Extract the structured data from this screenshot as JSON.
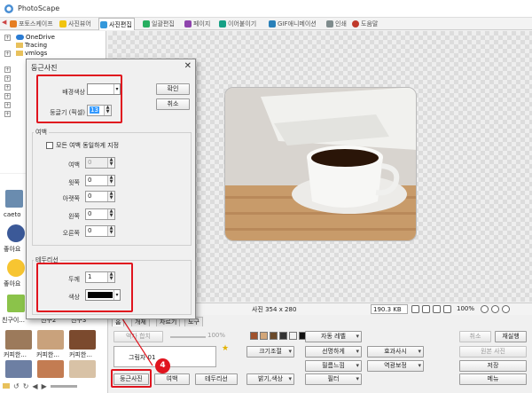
{
  "app": {
    "title": "PhotoScape"
  },
  "tabs": [
    {
      "label": "포토스케이프",
      "color": "#e67e22"
    },
    {
      "label": "사진뷰어",
      "color": "#f1c40f"
    },
    {
      "label": "사진편집",
      "color": "#3498db",
      "active": true
    },
    {
      "label": "일괄편집",
      "color": "#27ae60"
    },
    {
      "label": "페이지",
      "color": "#8e44ad"
    },
    {
      "label": "이어붙이기",
      "color": "#16a085"
    },
    {
      "label": "GIF애니메이션",
      "color": "#2980b9"
    },
    {
      "label": "인쇄",
      "color": "#7f8c8d"
    },
    {
      "label": "도움말",
      "color": "#c0392b"
    }
  ],
  "tree": [
    {
      "label": "OneDrive"
    },
    {
      "label": "Tracing"
    },
    {
      "label": "vmlogs"
    }
  ],
  "thumbs": {
    "labels": [
      "caeto",
      "좋아요",
      "좋아요",
      "친구이...",
      "친구2",
      "친구3",
      "커피한...",
      "커피한...",
      "커피한..."
    ]
  },
  "status": {
    "photo_size": "사진 354 x 280",
    "file_size": "190.3 KB",
    "zoom": "100%"
  },
  "tool_tabs": [
    "홈",
    "개체",
    "자르기",
    "도구"
  ],
  "bottom": {
    "frame_value": "그림자 01",
    "circle_button": "둥근사진",
    "margin_button": "여백",
    "outline_button": "테두리선",
    "zoom_slider": "100%",
    "left_top_disabled": "액자 합치",
    "col1": [
      "자동 레벨",
      "선명하게",
      "필름느낌",
      "필터"
    ],
    "col1b": [
      "크기조절",
      "밝기,색상"
    ],
    "col2": [
      "효과사시",
      "역광보정"
    ],
    "right_top": [
      "취소",
      "재실행"
    ],
    "right_mid": "원본 사진",
    "save": "저장",
    "menu": "메뉴"
  },
  "dialog": {
    "title": "둥근사진",
    "bg_color_label": "배경색상",
    "bg_color_value": "#ffffff",
    "roundness_label": "둥글기 (픽셀)",
    "roundness_value": "13",
    "ok_label": "확인",
    "cancel_label": "취소",
    "margin_group": "여백",
    "same_margin_label": "모든 여백 동일하게 지정",
    "margin_label": "여백",
    "margin_value": "0",
    "top_label": "윗쪽",
    "top_value": "0",
    "bottom_label": "아랫쪽",
    "bottom_value": "0",
    "left_label": "왼쪽",
    "left_value": "0",
    "right_label": "오른쪽",
    "right_value": "0",
    "outline_group": "테두리선",
    "thickness_label": "두께",
    "thickness_value": "1",
    "color_label": "색상",
    "color_value": "#000000"
  },
  "annotation": {
    "step": "4"
  }
}
